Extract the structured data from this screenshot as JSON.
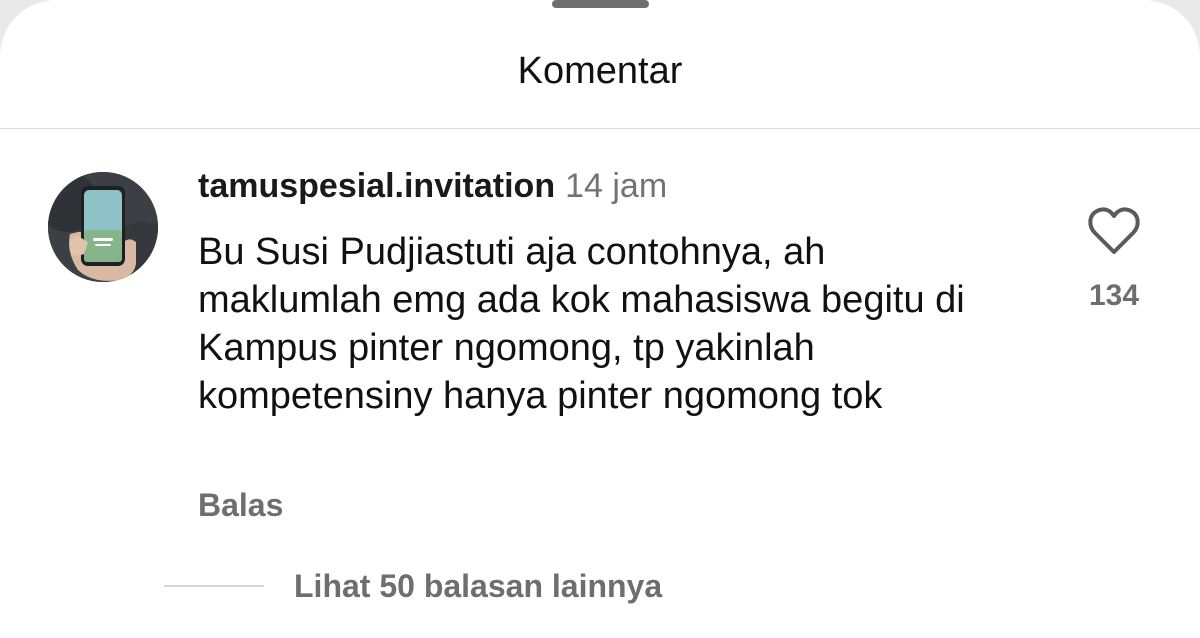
{
  "sheet": {
    "title": "Komentar"
  },
  "comment": {
    "username": "tamuspesial.invitation",
    "time": "14 jam",
    "text": "Bu Susi Pudjiastuti aja contohnya, ah maklumlah emg ada kok mahasiswa begitu di Kampus pinter ngomong, tp yakinlah kompetensiny hanya pinter ngomong tok",
    "reply_label": "Balas",
    "like_count": "134",
    "like_icon": "heart-outline-icon",
    "view_replies_label": "Lihat 50 balasan lainnya"
  },
  "colors": {
    "background": "#ffffff",
    "text": "#111111",
    "muted": "#6e6e6e",
    "divider": "#dcdcdc"
  }
}
